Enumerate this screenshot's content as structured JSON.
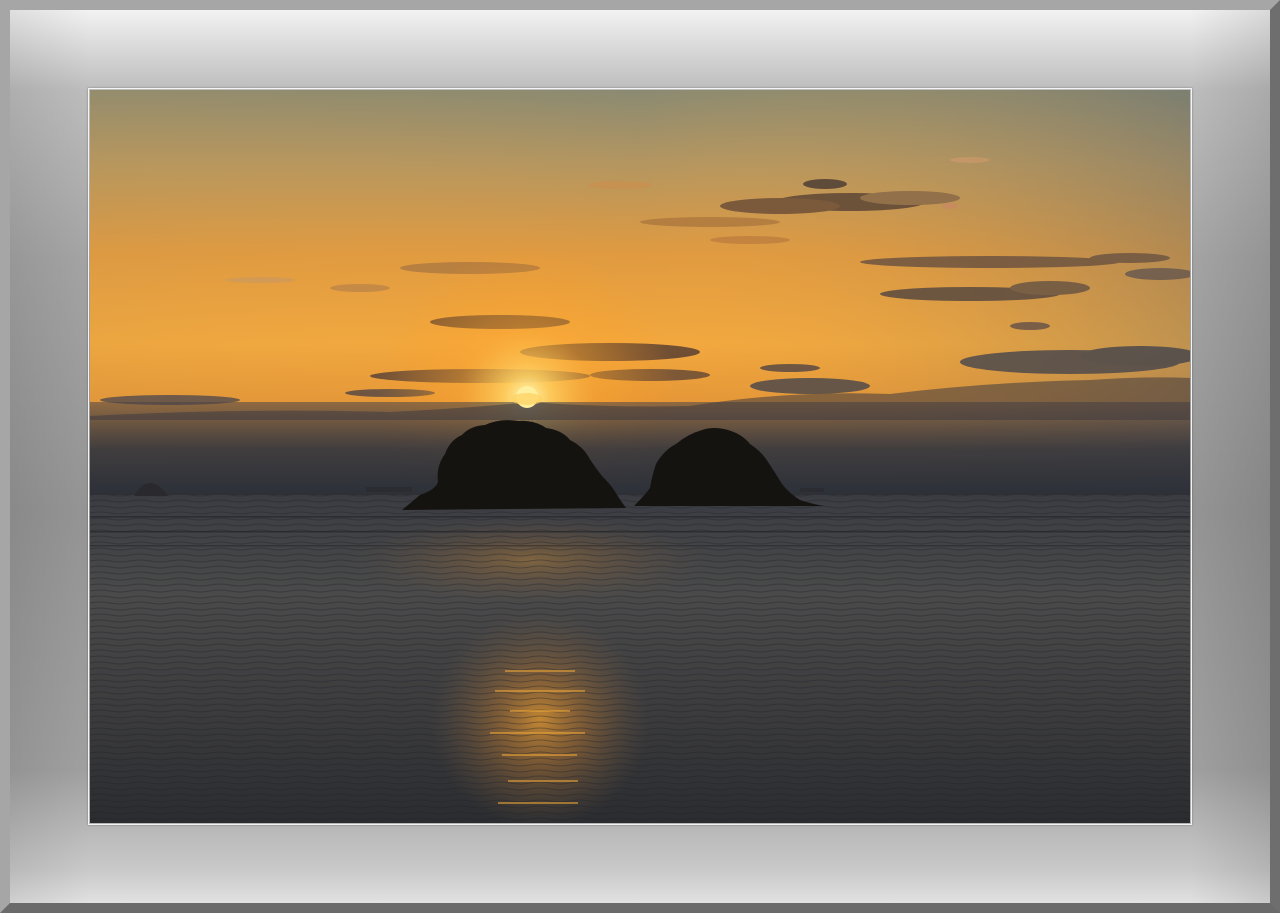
{
  "colors": {
    "frame_light": "#f2f2f2",
    "frame_mid": "#959595",
    "sky_top": "#8f8a70",
    "sky_mid": "#e8a040",
    "sky_horizon": "#f0b040",
    "haze": "#3a3d45",
    "sun": "#ffe890",
    "sea_dark": "#262a30",
    "sea_reflection": "#e89a30",
    "island": "#14120f"
  },
  "scene": {
    "subject": "sunset-over-sea-with-two-islands"
  }
}
